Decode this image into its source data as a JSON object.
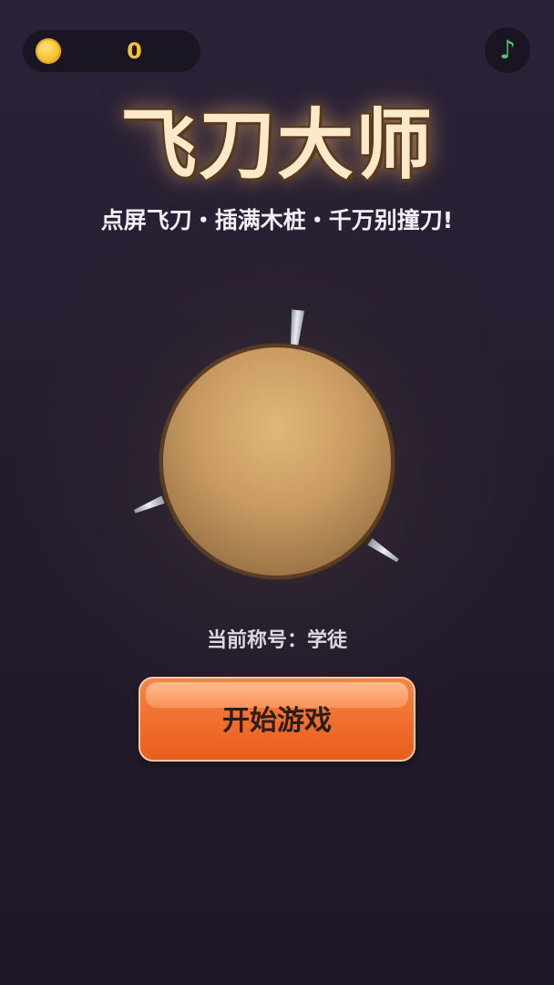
{
  "hud": {
    "coins": "0",
    "coin_icon": "coin-icon",
    "music_icon": "music-note-icon",
    "music_symbol": "♪"
  },
  "title": "飞刀大师",
  "subtitle": "点屏飞刀・插满木桩・千万别撞刀!",
  "rank_text": "当前称号：学徒",
  "start_button": "开始游戏",
  "game": {
    "target": "wooden-log-icon",
    "knives_stuck": 3
  },
  "colors": {
    "accent": "#ef6e2c",
    "coin": "#f7c232",
    "music": "#58c86a",
    "wood": "#d8a96c",
    "background": "#241c2e"
  }
}
